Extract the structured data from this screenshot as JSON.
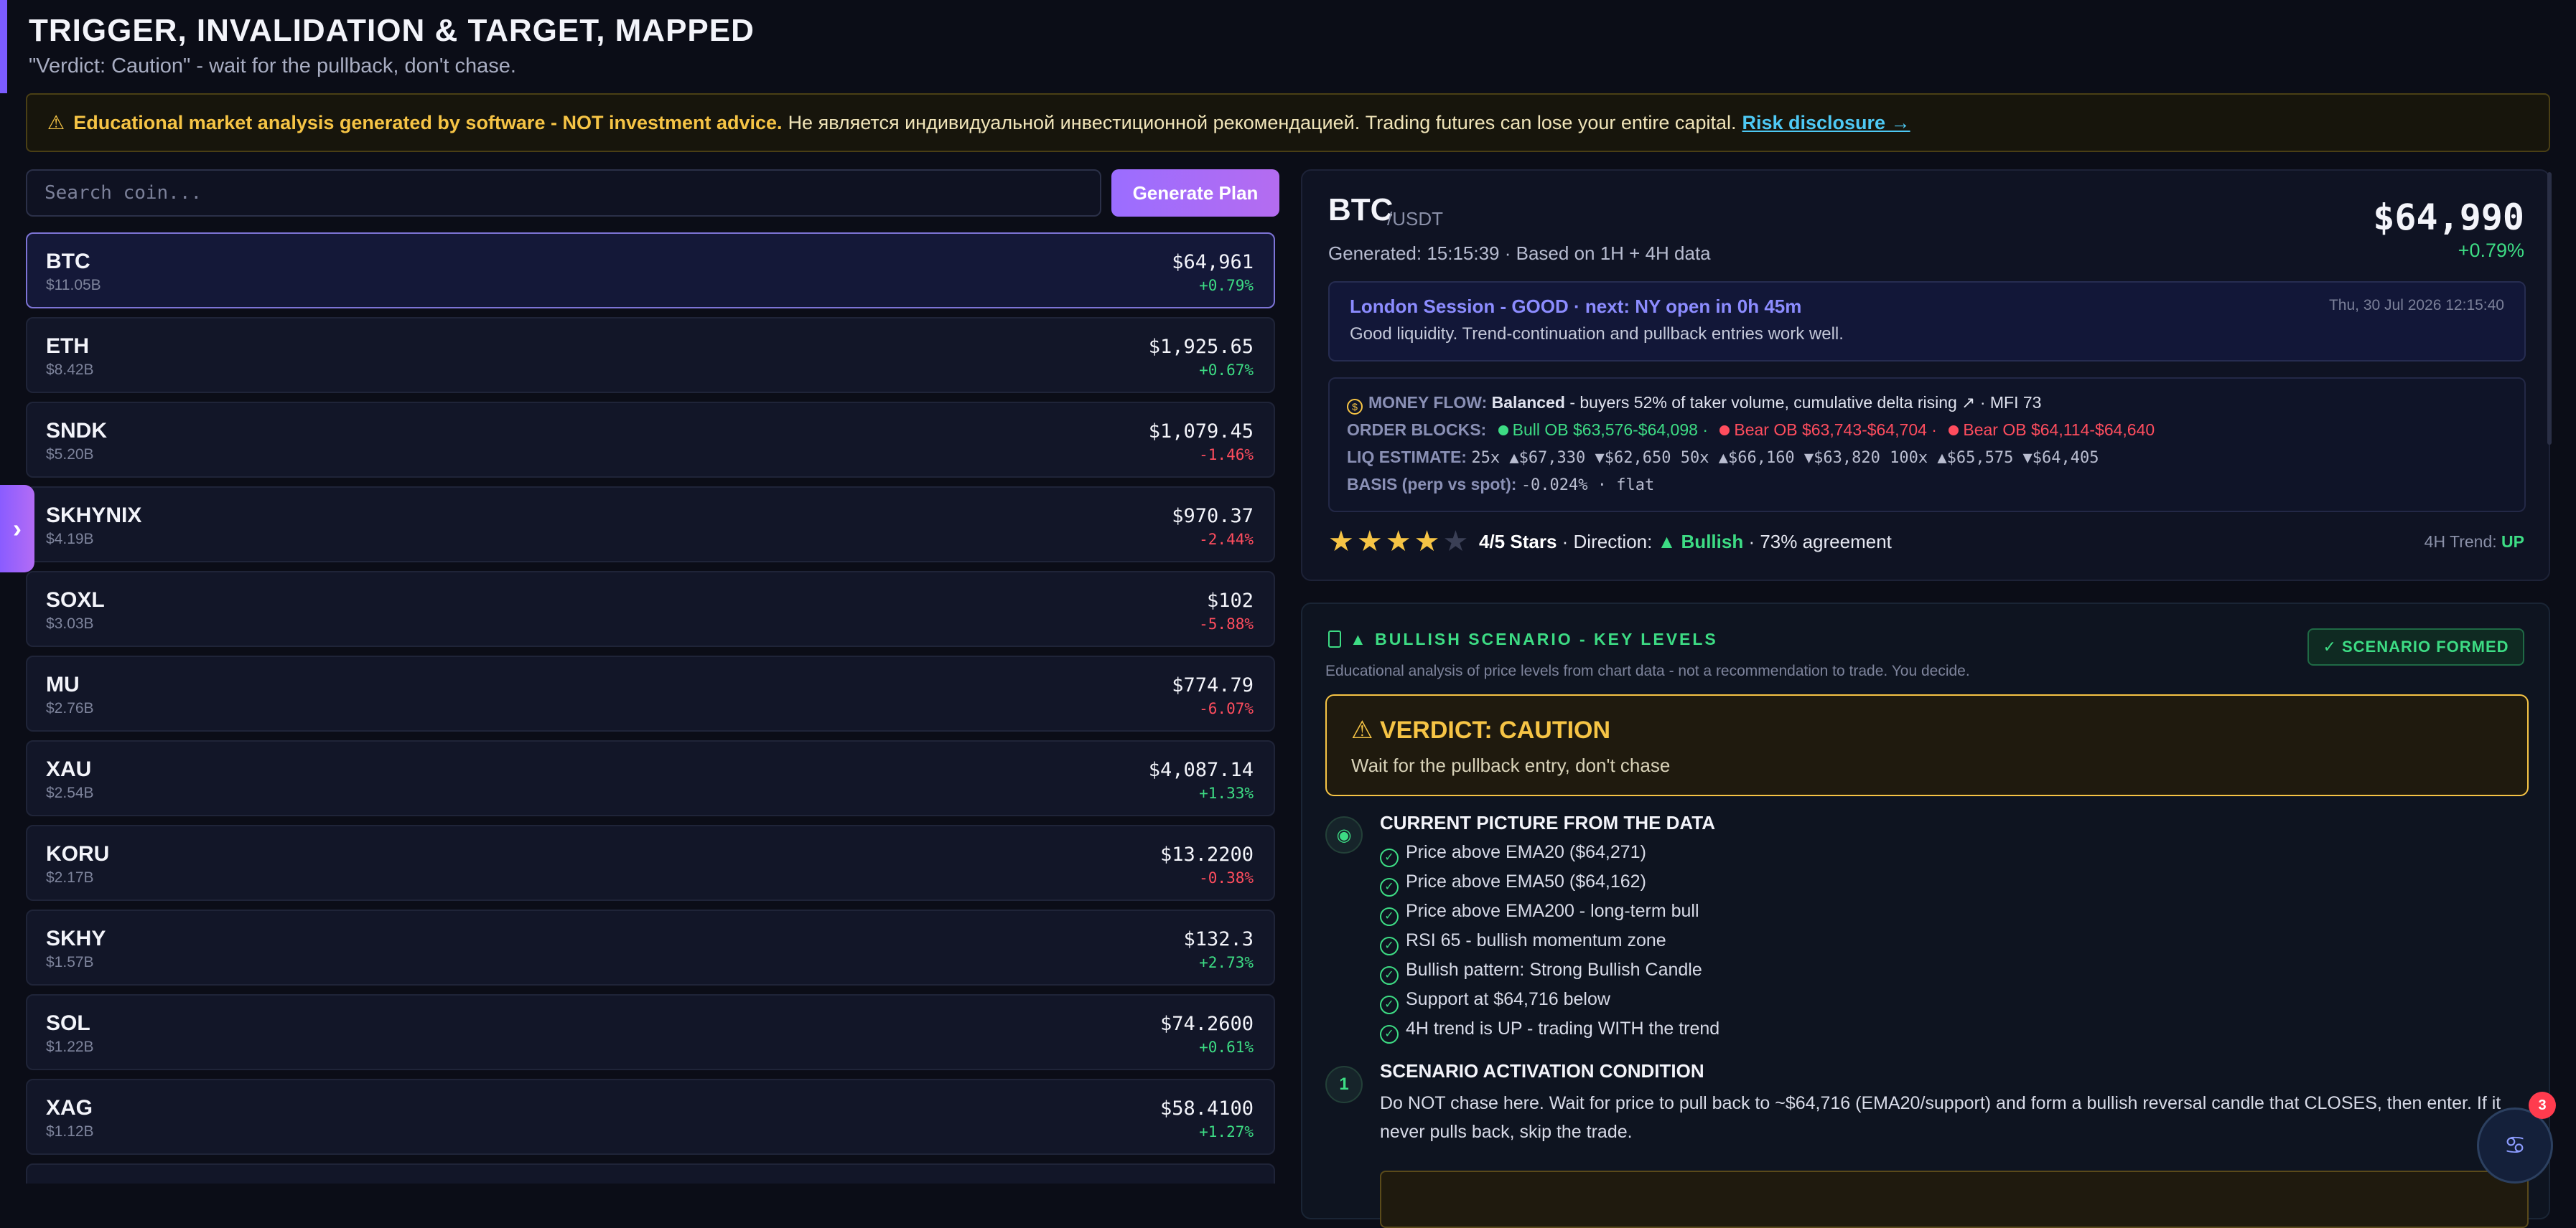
{
  "header": {
    "title": "TRIGGER, INVALIDATION & TARGET, MAPPED",
    "subtitle": "\"Verdict: Caution\" - wait for the pullback, don't chase."
  },
  "disclaimer": {
    "bold": "Educational market analysis generated by software - NOT investment advice.",
    "rest": "Не является индивидуальной инвестиционной рекомендацией. Trading futures can lose your entire capital.",
    "link": "Risk disclosure →"
  },
  "search": {
    "placeholder": "Search coin...",
    "button": "Generate Plan"
  },
  "coins": [
    {
      "sym": "BTC",
      "cap": "$11.05B",
      "price": "$64,961",
      "chg": "+0.79%",
      "dir": "up"
    },
    {
      "sym": "ETH",
      "cap": "$8.42B",
      "price": "$1,925.65",
      "chg": "+0.67%",
      "dir": "up"
    },
    {
      "sym": "SNDK",
      "cap": "$5.20B",
      "price": "$1,079.45",
      "chg": "-1.46%",
      "dir": "down"
    },
    {
      "sym": "SKHYNIX",
      "cap": "$4.19B",
      "price": "$970.37",
      "chg": "-2.44%",
      "dir": "down"
    },
    {
      "sym": "SOXL",
      "cap": "$3.03B",
      "price": "$102",
      "chg": "-5.88%",
      "dir": "down"
    },
    {
      "sym": "MU",
      "cap": "$2.76B",
      "price": "$774.79",
      "chg": "-6.07%",
      "dir": "down"
    },
    {
      "sym": "XAU",
      "cap": "$2.54B",
      "price": "$4,087.14",
      "chg": "+1.33%",
      "dir": "up"
    },
    {
      "sym": "KORU",
      "cap": "$2.17B",
      "price": "$13.2200",
      "chg": "-0.38%",
      "dir": "down"
    },
    {
      "sym": "SKHY",
      "cap": "$1.57B",
      "price": "$132.3",
      "chg": "+2.73%",
      "dir": "up"
    },
    {
      "sym": "SOL",
      "cap": "$1.22B",
      "price": "$74.2600",
      "chg": "+0.61%",
      "dir": "up"
    },
    {
      "sym": "XAG",
      "cap": "$1.12B",
      "price": "$58.4100",
      "chg": "+1.27%",
      "dir": "up"
    }
  ],
  "panel": {
    "sym": "BTC",
    "pair": "/USDT",
    "generated": "Generated: 15:15:39 · Based on 1H + 4H data",
    "price": "$64,990",
    "change": "+0.79%",
    "session": {
      "title": "London Session - GOOD · next: NY open in 0h 45m",
      "text": "Good liquidity. Trend-continuation and pullback entries work well.",
      "date": "Thu, 30 Jul 2026 12:15:40"
    },
    "flow": {
      "mf_label": "MONEY FLOW:",
      "mf_value": "Balanced",
      "mf_text": "- buyers 52% of taker volume, cumulative delta rising ↗ · MFI 73",
      "ob_label": "ORDER BLOCKS:",
      "ob_bull": "Bull OB $63,576-$64,098 ·",
      "ob_bear1": "Bear OB $63,743-$64,704 ·",
      "ob_bear2": "Bear OB $64,114-$64,640",
      "liq_label": "LIQ ESTIMATE:",
      "liq_text": "25x ▲$67,330 ▼$62,650 50x ▲$66,160 ▼$63,820 100x ▲$65,575 ▼$64,405",
      "basis_label": "BASIS (perp vs spot):",
      "basis_text": "-0.024% · flat"
    },
    "stars_on": "★★★★",
    "stars_off": "★",
    "stars_value": 4,
    "stars_text": "4/5 Stars",
    "direction_label": "· Direction:",
    "direction": "▲ Bullish",
    "agreement": "· 73% agreement",
    "trend_label": "4H Trend:",
    "trend": "UP"
  },
  "scenario": {
    "head": "▲ BULLISH SCENARIO - KEY LEVELS",
    "badge": "✓  SCENARIO FORMED",
    "edu": "Educational analysis of price levels from chart data - not a recommendation to trade. You decide.",
    "verdict_title": "VERDICT: CAUTION",
    "verdict_sub": "Wait for the pullback entry, don't chase",
    "picture_title": "CURRENT PICTURE FROM THE DATA",
    "checks": [
      "Price above EMA20 ($64,271)",
      "Price above EMA50 ($64,162)",
      "Price above EMA200 - long-term bull",
      "RSI 65 - bullish momentum zone",
      "Bullish pattern: Strong Bullish Candle",
      "Support at $64,716 below",
      "4H trend is UP - trading WITH the trend"
    ],
    "step1": "1",
    "cond_title": "SCENARIO ACTIVATION CONDITION",
    "cond_text": "Do NOT chase here. Wait for price to pull back to ~$64,716 (EMA20/support) and form a bullish reversal candle that CLOSES, then enter. If it never pulls back, skip the trade."
  },
  "fab": {
    "badge": "3"
  },
  "colors": {
    "accent": "#7c5cff",
    "up": "#3ddc84",
    "down": "#ff4d5e",
    "warn": "#f6c445"
  }
}
